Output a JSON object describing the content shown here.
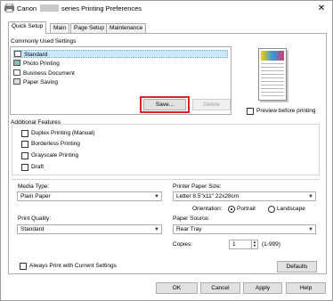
{
  "window": {
    "title_prefix": "Canon",
    "title_suffix": "series Printing Preferences",
    "close_glyph": "✕"
  },
  "tabs": [
    {
      "label": "Quick Setup"
    },
    {
      "label": "Main"
    },
    {
      "label": "Page Setup"
    },
    {
      "label": "Maintenance"
    }
  ],
  "common": {
    "label": "Commonly Used Settings",
    "items": [
      {
        "label": "Standard",
        "icon": "document-icon"
      },
      {
        "label": "Photo Printing",
        "icon": "photo-icon"
      },
      {
        "label": "Business Document",
        "icon": "document-icon"
      },
      {
        "label": "Paper Saving",
        "icon": "paper-saving-icon"
      }
    ],
    "save_label": "Save...",
    "delete_label": "Delete"
  },
  "preview": {
    "label": "Preview before printing"
  },
  "features": {
    "label": "Additional Features",
    "items": [
      {
        "label": "Duplex Printing (Manual)"
      },
      {
        "label": "Borderless Printing"
      },
      {
        "label": "Grayscale Printing"
      },
      {
        "label": "Draft"
      }
    ]
  },
  "media": {
    "label": "Media Type:",
    "value": "Plain Paper"
  },
  "paper_size": {
    "label": "Printer Paper Size:",
    "value": "Letter 8.5\"x11\" 22x28cm"
  },
  "orientation": {
    "label": "Orientation:",
    "portrait": "Portrait",
    "landscape": "Landscape"
  },
  "quality": {
    "label": "Print Quality:",
    "value": "Standard"
  },
  "source": {
    "label": "Paper Source:",
    "value": "Rear Tray"
  },
  "copies": {
    "label": "Copies:",
    "value": "1",
    "range": "(1-999)"
  },
  "always_print": {
    "label": "Always Print with Current Settings"
  },
  "buttons": {
    "defaults": "Defaults",
    "ok": "OK",
    "cancel": "Cancel",
    "apply": "Apply",
    "help": "Help"
  },
  "colors": {
    "highlight": "#d8242a",
    "selection": "#cce8ff"
  }
}
